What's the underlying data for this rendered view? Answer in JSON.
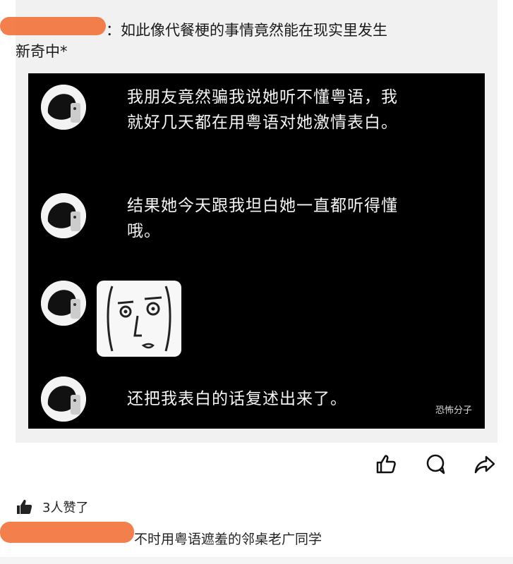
{
  "post": {
    "header_line1": "：如此像代餐梗的事情竟然能在现实里发生",
    "header_line2": "新奇中*"
  },
  "quote": {
    "messages": [
      {
        "text": "我朋友竟然骗我说她听不懂粤语，我就好几天都在用粤语对她激情表白。"
      },
      {
        "text": "结果她今天跟我坦白她一直都听得懂哦。"
      },
      {
        "text": "还把我表白的话复述出来了。"
      }
    ],
    "watermark": "恐怖分子"
  },
  "actions": {
    "icons": [
      "thumbs-up-icon",
      "comment-icon",
      "share-icon"
    ]
  },
  "likes": {
    "label": "3人赞了"
  },
  "comment": {
    "text": "不时用粤语遮羞的邻桌老广同学"
  },
  "colors": {
    "redaction": "#f2743e",
    "quote_bg": "#000000",
    "card_bg": "#f1f1f1"
  }
}
